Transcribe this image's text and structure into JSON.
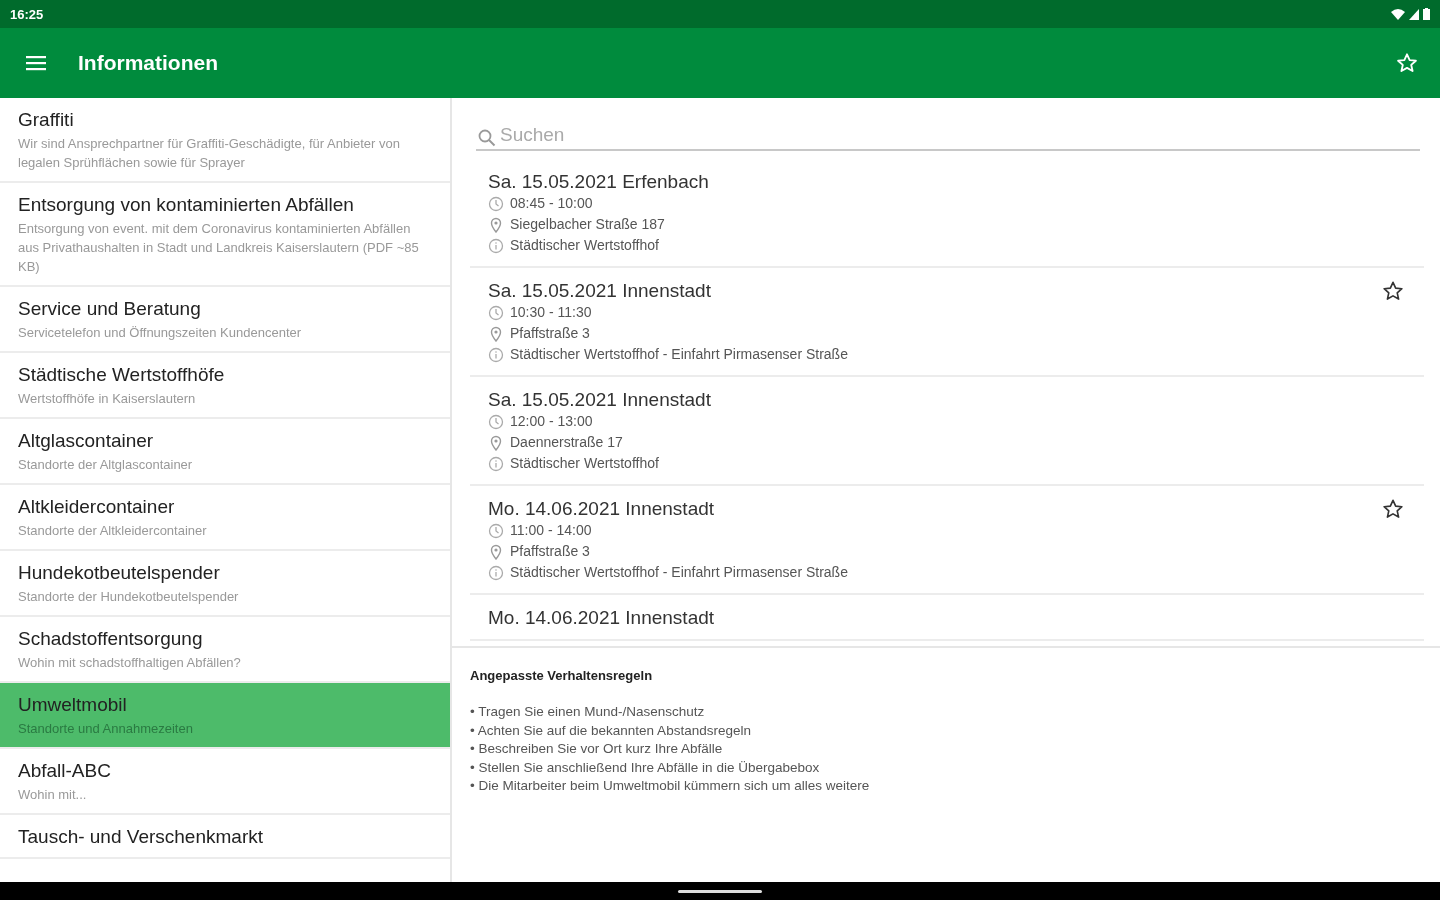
{
  "status_bar": {
    "time": "16:25"
  },
  "app_bar": {
    "title": "Informationen"
  },
  "sidebar": {
    "items": [
      {
        "title": "Graffiti",
        "subtitle": "Wir sind Ansprechpartner für Graffiti-Geschädigte, für Anbieter von legalen Sprühflächen sowie für Sprayer",
        "selected": false
      },
      {
        "title": "Entsorgung von kontaminierten Abfällen",
        "subtitle": "Entsorgung von event. mit dem Coronavirus kontaminierten Abfällen aus Privathaushalten in Stadt und Landkreis Kaiserslautern (PDF ~85 KB)",
        "selected": false
      },
      {
        "title": "Service und Beratung",
        "subtitle": "Servicetelefon und Öffnungszeiten Kundencenter",
        "selected": false
      },
      {
        "title": "Städtische Wertstoffhöfe",
        "subtitle": "Wertstoffhöfe in Kaiserslautern",
        "selected": false
      },
      {
        "title": "Altglascontainer",
        "subtitle": "Standorte der Altglascontainer",
        "selected": false
      },
      {
        "title": "Altkleidercontainer",
        "subtitle": "Standorte der Altkleidercontainer",
        "selected": false
      },
      {
        "title": "Hundekotbeutelspender",
        "subtitle": "Standorte der Hundekotbeutelspender",
        "selected": false
      },
      {
        "title": "Schadstoffentsorgung",
        "subtitle": "Wohin mit schadstoffhaltigen Abfällen?",
        "selected": false
      },
      {
        "title": "Umweltmobil",
        "subtitle": "Standorte und Annahmezeiten",
        "selected": true
      },
      {
        "title": "Abfall-ABC",
        "subtitle": "Wohin mit...",
        "selected": false
      },
      {
        "title": "Tausch- und Verschenkmarkt",
        "selected": false
      }
    ]
  },
  "search": {
    "placeholder": "Suchen"
  },
  "events": [
    {
      "title": "Sa. 15.05.2021 Erfenbach",
      "time": "08:45 - 10:00",
      "address": "Siegelbacher Straße 187",
      "note": "Städtischer Wertstoffhof",
      "favorite_toggle": false
    },
    {
      "title": "Sa. 15.05.2021 Innenstadt",
      "time": "10:30 - 11:30",
      "address": "Pfaffstraße 3",
      "note": "Städtischer Wertstoffhof - Einfahrt Pirmasenser Straße",
      "favorite_toggle": true
    },
    {
      "title": "Sa. 15.05.2021 Innenstadt",
      "time": "12:00 - 13:00",
      "address": "Daennerstraße 17",
      "note": "Städtischer Wertstoffhof",
      "favorite_toggle": false
    },
    {
      "title": "Mo. 14.06.2021 Innenstadt",
      "time": "11:00 - 14:00",
      "address": "Pfaffstraße 3",
      "note": "Städtischer Wertstoffhof - Einfahrt Pirmasenser Straße",
      "favorite_toggle": true
    },
    {
      "title": "Mo. 14.06.2021 Innenstadt",
      "favorite_toggle": false
    }
  ],
  "info": {
    "heading": "Angepasste Verhaltensregeln",
    "lines": [
      "• Tragen Sie einen Mund-/Nasenschutz",
      "• Achten Sie auf die bekannten Abstandsregeln",
      "• Beschreiben Sie vor Ort kurz Ihre Abfälle",
      "• Stellen Sie anschließend Ihre Abfälle in die Übergabebox",
      "• Die Mitarbeiter beim Umweltmobil kümmern sich um alles weitere"
    ]
  }
}
